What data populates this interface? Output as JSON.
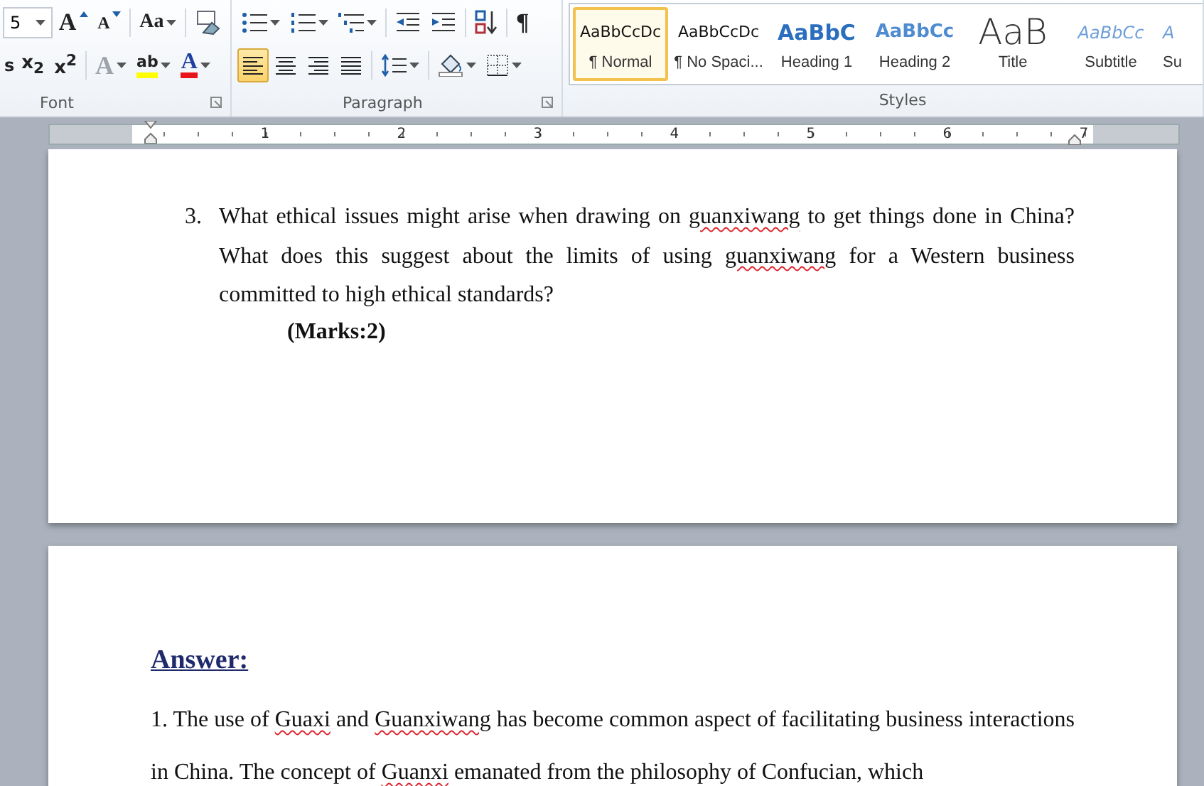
{
  "ribbon": {
    "font_group": {
      "label": "Font",
      "size_field": {
        "value": "5"
      },
      "row1": [
        {
          "kind": "grow-font",
          "label": "A"
        },
        {
          "kind": "shrink-font",
          "label": "A"
        },
        {
          "kind": "separator"
        },
        {
          "kind": "change-case",
          "label": "Aa",
          "dropdown": true
        },
        {
          "kind": "separator"
        },
        {
          "kind": "clear-format"
        }
      ],
      "row2": [
        {
          "kind": "strike-cut",
          "label": "s"
        },
        {
          "kind": "script",
          "label": "x$_{2}$"
        },
        {
          "kind": "script",
          "label": "x$^{2}$"
        },
        {
          "kind": "separator"
        },
        {
          "kind": "text-effects",
          "label": "A",
          "disabled": true,
          "dropdown": true
        },
        {
          "kind": "highlight",
          "label": "ab",
          "color": "#ffff00",
          "dropdown": true
        },
        {
          "kind": "font-color",
          "label": "A",
          "color": "#e8141b",
          "dropdown": true
        }
      ]
    },
    "paragraph_group": {
      "label": "Paragraph",
      "row1": [
        {
          "kind": "bullets",
          "dropdown": true
        },
        {
          "kind": "numbering",
          "dropdown": true
        },
        {
          "kind": "multilevel",
          "dropdown": true
        },
        {
          "kind": "separator"
        },
        {
          "kind": "decrease-indent"
        },
        {
          "kind": "increase-indent"
        },
        {
          "kind": "separator"
        },
        {
          "kind": "sort"
        },
        {
          "kind": "separator"
        },
        {
          "kind": "pilcrow",
          "label": "¶"
        }
      ],
      "row2": [
        {
          "kind": "align-left",
          "selected": true
        },
        {
          "kind": "align-center",
          "selected": false
        },
        {
          "kind": "align-right",
          "selected": false
        },
        {
          "kind": "justify",
          "selected": false
        },
        {
          "kind": "separator"
        },
        {
          "kind": "line-spacing",
          "dropdown": true
        },
        {
          "kind": "separator"
        },
        {
          "kind": "shading",
          "dropdown": true
        },
        {
          "kind": "borders",
          "dropdown": true
        }
      ]
    },
    "styles_group": {
      "label": "Styles",
      "items": [
        {
          "preview": "AaBbCcDc",
          "name": "¶ Normal",
          "kind": "normal",
          "selected": true
        },
        {
          "preview": "AaBbCcDc",
          "name": "¶ No Spaci...",
          "kind": "normal",
          "selected": false
        },
        {
          "preview": "AaBbC",
          "name": "Heading 1",
          "kind": "heading1",
          "selected": false
        },
        {
          "preview": "AaBbCc",
          "name": "Heading 2",
          "kind": "heading2",
          "selected": false
        },
        {
          "preview": "AaB",
          "name": "Title",
          "kind": "title",
          "selected": false
        },
        {
          "preview": "AaBbCc",
          "name": "Subtitle",
          "kind": "subtitle",
          "selected": false
        },
        {
          "preview": "A",
          "name": "Su",
          "kind": "subtitle",
          "selected": false
        }
      ]
    }
  },
  "ruler": {
    "numbers": [
      "1",
      "2",
      "3",
      "4",
      "5",
      "6",
      "7"
    ]
  },
  "pages": [
    {
      "question": {
        "number": "3.",
        "segments": [
          {
            "text": "What ethical issues might arise when drawing on ",
            "misspelled": false
          },
          {
            "text": "guanxiwang",
            "misspelled": true
          },
          {
            "text": " to get things done in China? What does this suggest about the limits of using ",
            "misspelled": false
          },
          {
            "text": "guanxiwang",
            "misspelled": true
          },
          {
            "text": " for a Western business committed to high ethical standards?",
            "misspelled": false
          }
        ],
        "marks": "(Marks:2)"
      }
    },
    {
      "heading": "Answer:",
      "paragraph": [
        {
          "text": "1. The use of ",
          "misspelled": false
        },
        {
          "text": "Guaxi",
          "misspelled": true
        },
        {
          "text": " and ",
          "misspelled": false
        },
        {
          "text": "Guanxiwang",
          "misspelled": true
        },
        {
          "text": " has become common aspect of facilitating business interactions in China. The concept of ",
          "misspelled": false
        },
        {
          "text": "Guanxi",
          "misspelled": true
        },
        {
          "text": " emanated from the philosophy of Confucian, which",
          "misspelled": false
        }
      ]
    }
  ]
}
